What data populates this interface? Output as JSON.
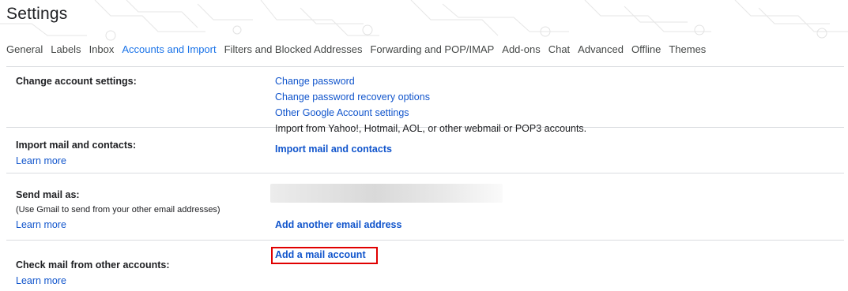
{
  "page": {
    "title": "Settings"
  },
  "tabs": [
    {
      "label": "General",
      "active": false
    },
    {
      "label": "Labels",
      "active": false
    },
    {
      "label": "Inbox",
      "active": false
    },
    {
      "label": "Accounts and Import",
      "active": true
    },
    {
      "label": "Filters and Blocked Addresses",
      "active": false
    },
    {
      "label": "Forwarding and POP/IMAP",
      "active": false
    },
    {
      "label": "Add-ons",
      "active": false
    },
    {
      "label": "Chat",
      "active": false
    },
    {
      "label": "Advanced",
      "active": false
    },
    {
      "label": "Offline",
      "active": false
    },
    {
      "label": "Themes",
      "active": false
    }
  ],
  "sections": {
    "change_account": {
      "label": "Change account settings:",
      "links": [
        "Change password",
        "Change password recovery options",
        "Other Google Account settings"
      ]
    },
    "import": {
      "label": "Import mail and contacts:",
      "learn_more": "Learn more",
      "description": "Import from Yahoo!, Hotmail, AOL, or other webmail or POP3 accounts.",
      "action": "Import mail and contacts"
    },
    "send_as": {
      "label": "Send mail as:",
      "sublabel": "(Use Gmail to send from your other email addresses)",
      "learn_more": "Learn more",
      "action": "Add another email address"
    },
    "check_mail": {
      "label": "Check mail from other accounts:",
      "learn_more": "Learn more",
      "action": "Add a mail account"
    }
  },
  "colors": {
    "link": "#1155cc",
    "active_tab": "#1a73e8",
    "highlight_border": "#e00000",
    "divider": "#dadce0"
  }
}
